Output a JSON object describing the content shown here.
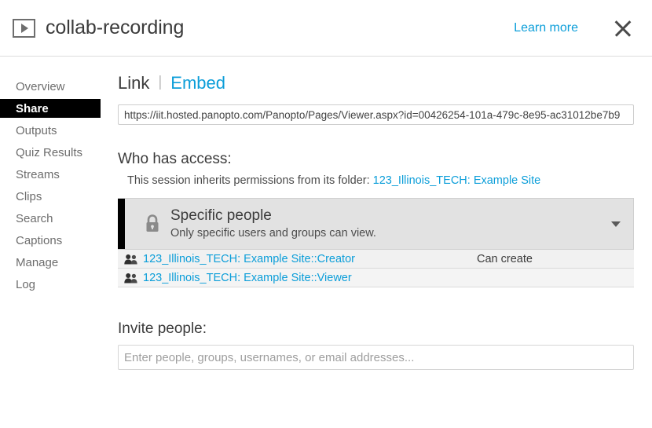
{
  "header": {
    "icon": "video-play-icon",
    "title": "collab-recording",
    "learn_more_label": "Learn more",
    "close_icon": "close-icon"
  },
  "sidebar": {
    "items": [
      {
        "label": "Overview",
        "active": false
      },
      {
        "label": "Share",
        "active": true
      },
      {
        "label": "Outputs",
        "active": false
      },
      {
        "label": "Quiz Results",
        "active": false
      },
      {
        "label": "Streams",
        "active": false
      },
      {
        "label": "Clips",
        "active": false
      },
      {
        "label": "Search",
        "active": false
      },
      {
        "label": "Captions",
        "active": false
      },
      {
        "label": "Manage",
        "active": false
      },
      {
        "label": "Log",
        "active": false
      }
    ]
  },
  "main": {
    "tabs": {
      "link_label": "Link",
      "separator": "|",
      "embed_label": "Embed"
    },
    "link_url": "https://iit.hosted.panopto.com/Panopto/Pages/Viewer.aspx?id=00426254-101a-479c-8e95-ac31012be7b9",
    "access": {
      "heading": "Who has access:",
      "inherit_prefix": "This session inherits permissions from its folder:",
      "inherit_folder": "123_Illinois_TECH: Example Site",
      "selector": {
        "icon": "lock-icon",
        "title": "Specific people",
        "subtitle": "Only specific users and groups can view.",
        "chevron_icon": "chevron-down-icon"
      },
      "rows": [
        {
          "icon": "group-icon",
          "name": "123_Illinois_TECH: Example Site::Creator",
          "role": "Can create"
        },
        {
          "icon": "group-icon",
          "name": "123_Illinois_TECH: Example Site::Viewer",
          "role": ""
        }
      ]
    },
    "invite": {
      "heading": "Invite people:",
      "placeholder": "Enter people, groups, usernames, or email addresses...",
      "value": ""
    }
  },
  "colors": {
    "link_blue": "#0c9ed9",
    "active_nav_bg": "#000000",
    "panel_bg": "#e2e2e2",
    "row_bg": "#f1f1f1",
    "text": "#3b3b3b"
  }
}
